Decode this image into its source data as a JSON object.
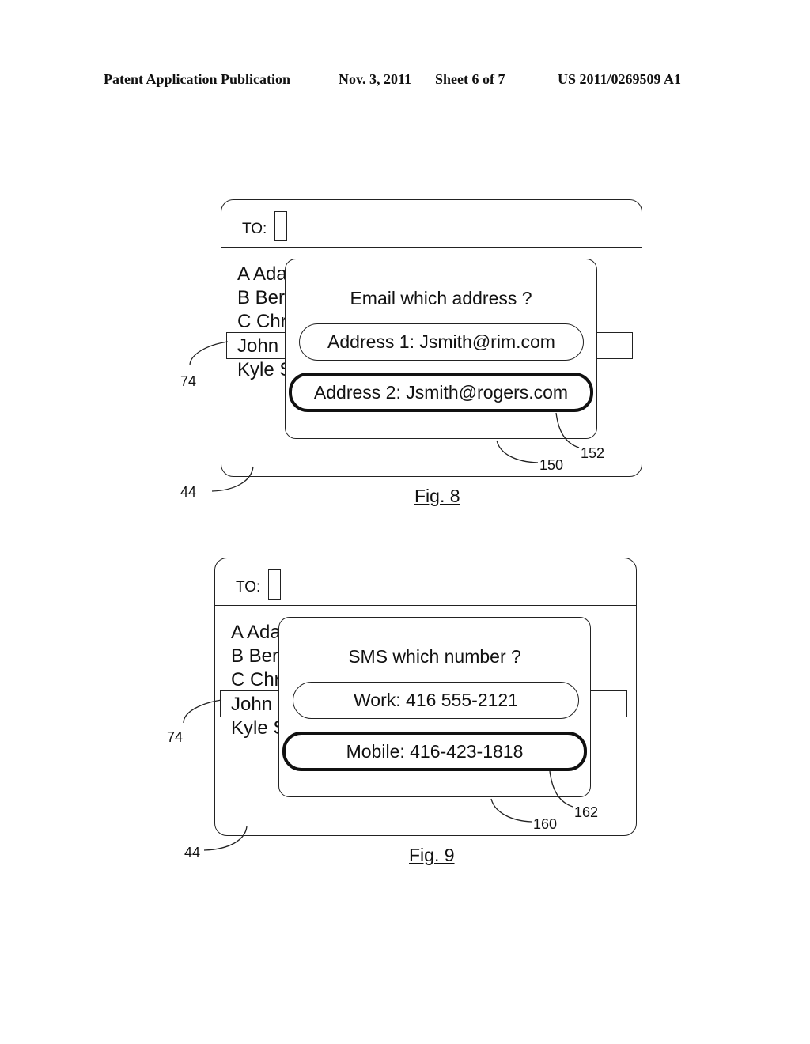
{
  "header": {
    "publication": "Patent Application Publication",
    "date": "Nov. 3, 2011",
    "sheet": "Sheet 6 of 7",
    "number": "US 2011/0269509 A1"
  },
  "figures": [
    {
      "caption": "Fig. 8",
      "to_label": "TO:",
      "list_items": [
        "A Ada",
        "B Ber",
        "C Chr",
        "John",
        "Kyle S"
      ],
      "popup": {
        "title": "Email which  address ?",
        "options": [
          {
            "label": "Address 1: Jsmith@rim.com",
            "selected": false
          },
          {
            "label": "Address 2: Jsmith@rogers.com",
            "selected": true
          }
        ]
      },
      "refs": {
        "selected_item": "74",
        "screen": "44",
        "popup": "150",
        "selected_option": "152"
      }
    },
    {
      "caption": "Fig. 9",
      "to_label": "TO:",
      "list_items": [
        "A Ada",
        "B Ber",
        "C Chr",
        "John",
        "Kyle S"
      ],
      "popup": {
        "title": "SMS which number ?",
        "options": [
          {
            "label": "Work: 416 555-2121",
            "selected": false
          },
          {
            "label": "Mobile: 416-423-1818",
            "selected": true
          }
        ]
      },
      "refs": {
        "selected_item": "74",
        "screen": "44",
        "popup": "160",
        "selected_option": "162"
      }
    }
  ]
}
